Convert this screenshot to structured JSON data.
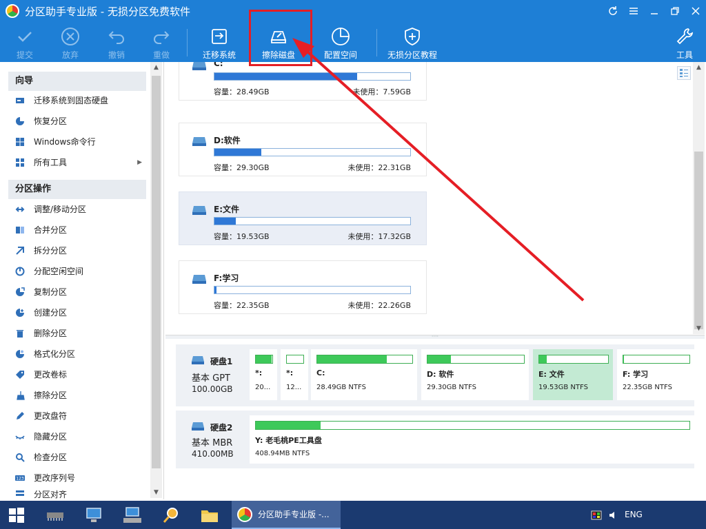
{
  "window": {
    "title": "分区助手专业版 - 无损分区免费软件",
    "controls": [
      "refresh-icon",
      "menu-icon",
      "minimize-icon",
      "restore-icon",
      "close-icon"
    ]
  },
  "toolbar": {
    "commit": "提交",
    "discard": "放弃",
    "undo": "撤销",
    "redo": "重做",
    "migrate": "迁移系统",
    "wipe": "擦除磁盘",
    "allocate": "配置空间",
    "tutorial": "无损分区教程",
    "tools": "工具"
  },
  "sidebar": {
    "wizard_title": "向导",
    "wizard_items": [
      "迁移系统到固态硬盘",
      "恢复分区",
      "Windows命令行",
      "所有工具"
    ],
    "ops_title": "分区操作",
    "ops_items": [
      "调整/移动分区",
      "合并分区",
      "拆分分区",
      "分配空闲空间",
      "复制分区",
      "创建分区",
      "删除分区",
      "格式化分区",
      "更改卷标",
      "擦除分区",
      "更改盘符",
      "隐藏分区",
      "检查分区",
      "更改序列号",
      "分区对齐"
    ]
  },
  "partitions": [
    {
      "name": "C:",
      "capacity": "容量：28.49GB",
      "free": "未使用：7.59GB",
      "used_fraction": 0.73
    },
    {
      "name": "D:软件",
      "capacity": "容量：29.30GB",
      "free": "未使用：22.31GB",
      "used_fraction": 0.24
    },
    {
      "name": "E:文件",
      "capacity": "容量：19.53GB",
      "free": "未使用：17.32GB",
      "used_fraction": 0.11,
      "selected": true
    },
    {
      "name": "F:学习",
      "capacity": "容量：22.35GB",
      "free": "未使用：22.26GB",
      "used_fraction": 0.01
    }
  ],
  "disks": [
    {
      "name": "硬盘1",
      "type": "基本 GPT",
      "size": "100.00GB",
      "parts": [
        {
          "label": "*:",
          "fs": "20...",
          "used_fraction": 0.95
        },
        {
          "label": "*:",
          "fs": "12...",
          "used_fraction": 0.0
        },
        {
          "label": "C:",
          "fs": "28.49GB NTFS",
          "used_fraction": 0.73
        },
        {
          "label": "D: 软件",
          "fs": "29.30GB NTFS",
          "used_fraction": 0.24
        },
        {
          "label": "E: 文件",
          "fs": "19.53GB NTFS",
          "used_fraction": 0.11,
          "selected": true
        },
        {
          "label": "F: 学习",
          "fs": "22.35GB NTFS",
          "used_fraction": 0.01
        }
      ]
    },
    {
      "name": "硬盘2",
      "type": "基本 MBR",
      "size": "410.00MB",
      "parts": [
        {
          "label": "Y: 老毛桃PE工具盘",
          "fs": "408.94MB NTFS",
          "used_fraction": 0.15
        }
      ]
    }
  ],
  "taskbar": {
    "active_app": "分区助手专业版 -...",
    "lang": "ENG",
    "icons": [
      "windows-start-icon",
      "hardware-chip-icon",
      "computer-network-icon",
      "keyboard-computer-icon",
      "search-tool-icon",
      "file-explorer-icon"
    ]
  },
  "colors": {
    "accent": "#1e7fd6",
    "bar_blue": "#2f78d6",
    "bar_green": "#3ec95a",
    "annotation_red": "#e51e25"
  }
}
